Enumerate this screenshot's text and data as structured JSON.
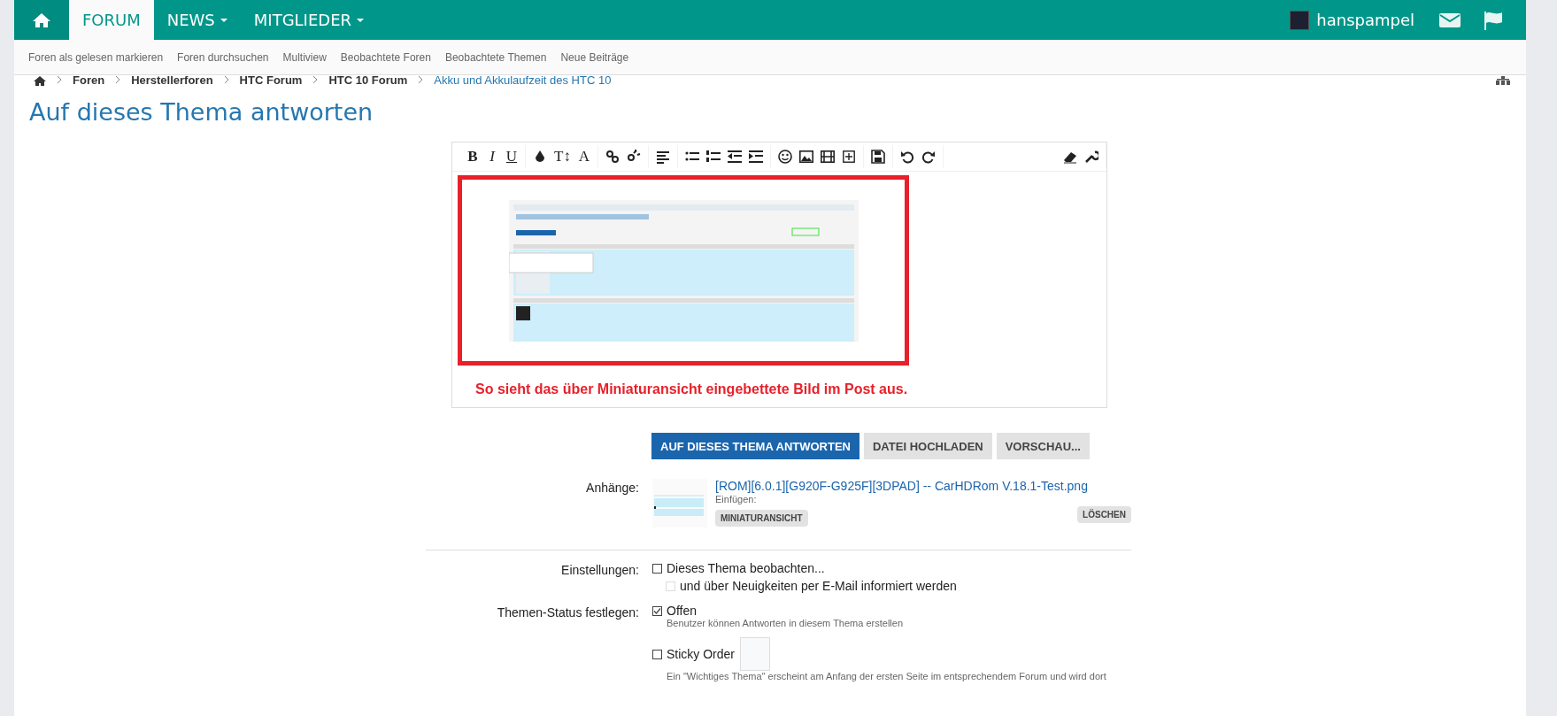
{
  "nav": {
    "tabs": [
      {
        "kind": "home",
        "selected": false
      },
      {
        "label": "FORUM",
        "selected": true,
        "dropdown": false
      },
      {
        "label": "NEWS",
        "selected": false,
        "dropdown": true
      },
      {
        "label": "MITGLIEDER",
        "selected": false,
        "dropdown": true
      }
    ],
    "user": "hanspampel"
  },
  "subnav": [
    "Foren als gelesen markieren",
    "Foren durchsuchen",
    "Multiview",
    "Beobachtete Foren",
    "Beobachtete Themen",
    "Neue Beiträge"
  ],
  "breadcrumb": [
    "Foren",
    "Herstellerforen",
    "HTC Forum",
    "HTC 10 Forum",
    "Akku und Akkulaufzeit des HTC 10"
  ],
  "title": "Auf dieses Thema antworten",
  "editor": {
    "toolbar": [
      [
        {
          "label": "B"
        },
        {
          "label": "I"
        },
        {
          "label": "U"
        }
      ],
      [
        {
          "kind": "icon"
        },
        {
          "label": "T↕"
        },
        {
          "label": "A"
        }
      ],
      [
        {
          "kind": "icon"
        },
        {
          "kind": "icon"
        }
      ],
      [
        {
          "kind": "icon"
        }
      ],
      [
        {
          "kind": "icon"
        },
        {
          "kind": "icon"
        },
        {
          "kind": "icon"
        },
        {
          "kind": "icon"
        }
      ],
      [
        {
          "kind": "icon"
        },
        {
          "kind": "icon"
        },
        {
          "kind": "icon"
        },
        {
          "kind": "icon"
        }
      ],
      [
        {
          "kind": "icon"
        }
      ],
      [
        {
          "kind": "icon"
        },
        {
          "kind": "icon"
        }
      ]
    ],
    "toolbar_right": [
      {
        "kind": "icon"
      },
      {
        "kind": "icon"
      }
    ],
    "image": {
      "kind": "picture"
    },
    "caption": "So sieht das über Miniaturansicht eingebettete Bild im Post aus."
  },
  "buttons": [
    {
      "label": "AUF DIESES THEMA ANTWORTEN",
      "primary": true
    },
    {
      "label": "DATEI HOCHLADEN",
      "primary": false
    },
    {
      "label": "VORSCHAU...",
      "primary": false
    }
  ],
  "attachments": {
    "label": "Anhänge:",
    "file": "[ROM][6.0.1][G920F-G925F][3DPAD] -- CarHDRom V.18.1-Test.png",
    "insert_label": "Einfügen:",
    "thumbnail_button": "MINIATURANSICHT",
    "delete_button": "LÖSCHEN"
  },
  "settings": [
    {
      "label": "Einstellungen:",
      "options": [
        {
          "text": "Dieses Thema beobachten...",
          "checked": false,
          "disabled": false
        },
        {
          "text": "und über Neuigkeiten per E-Mail informiert werden",
          "checked": false,
          "disabled": true,
          "indent": true
        }
      ]
    },
    {
      "label": "Themen-Status festlegen:",
      "options": [
        {
          "text": "Offen",
          "checked": true,
          "disabled": false,
          "hint": "Benutzer können Antworten in diesem Thema erstellen"
        },
        {
          "text": "Sticky Order",
          "checked": false,
          "disabled": false,
          "order_field": true,
          "hint": "Ein \"Wichtiges Thema\" erscheint am Anfang der ersten Seite im entsprechendem Forum und wird dort"
        }
      ]
    }
  ]
}
